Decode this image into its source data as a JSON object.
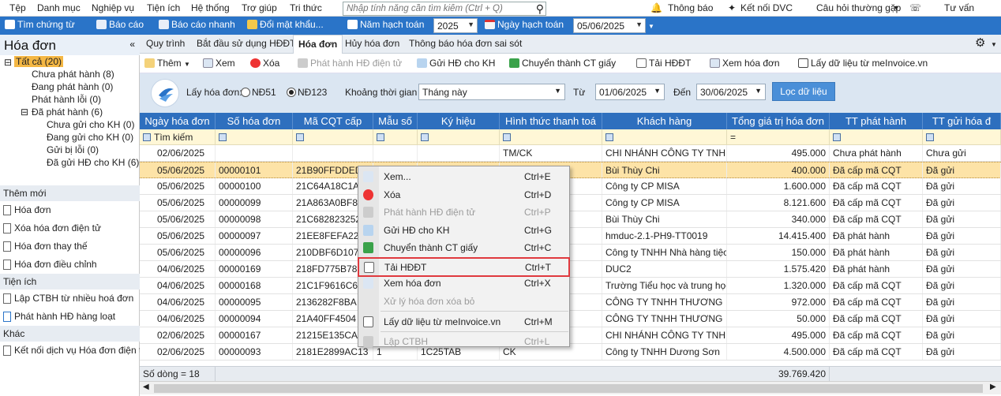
{
  "menubar": {
    "items": [
      "Tệp",
      "Danh mục",
      "Nghiệp vụ",
      "Tiện ích",
      "Hệ thống",
      "Trợ giúp",
      "Tri thức"
    ],
    "search_placeholder": "Nhập tính năng cần tìm kiếm (Ctrl + Q)",
    "right": [
      "Thông báo",
      "Kết nối DVC",
      "Câu hỏi thường gặp",
      "Tư vấn"
    ]
  },
  "toolbar": {
    "find_voucher": "Tìm chứng từ",
    "report": "Báo cáo",
    "quick_report": "Báo cáo nhanh",
    "change_password": "Đổi mật khẩu...",
    "year_label": "Năm hạch toán",
    "year_value": "2025",
    "date_label": "Ngày hạch toán",
    "date_value": "05/06/2025"
  },
  "sidebar": {
    "title": "Hóa đơn",
    "tree": [
      {
        "label": "Tất cả (20)",
        "selected": true,
        "level": 0
      },
      {
        "label": "Chưa phát hành (8)",
        "level": 1
      },
      {
        "label": "Đang phát hành (0)",
        "level": 1
      },
      {
        "label": "Phát hành lỗi (0)",
        "level": 1
      },
      {
        "label": "Đã phát hành (6)",
        "level": 1
      },
      {
        "label": "Chưa gửi cho KH (0)",
        "level": 2
      },
      {
        "label": "Đang gửi cho KH (0)",
        "level": 2
      },
      {
        "label": "Gửi bị lỗi (0)",
        "level": 2
      },
      {
        "label": "Đã gửi HĐ cho KH (6)",
        "level": 2
      }
    ],
    "section_new": "Thêm mới",
    "new_links": [
      "Hóa đơn",
      "Xóa hóa đơn điện tử",
      "Hóa đơn thay thế",
      "Hóa đơn điều chỉnh"
    ],
    "section_util": "Tiện ích",
    "util_links": [
      "Lập CTBH từ nhiều hoá đơn",
      "Phát hành HĐ hàng loạt"
    ],
    "section_other": "Khác",
    "other_links": [
      "Kết nối dịch vụ Hóa đơn điện t"
    ]
  },
  "tabs": [
    "Quy trình",
    "Bắt đầu sử dụng HĐĐT",
    "Hóa đơn",
    "Hủy hóa đơn",
    "Thông báo hóa đơn sai sót"
  ],
  "actions": {
    "add": "Thêm",
    "view": "Xem",
    "delete": "Xóa",
    "issue": "Phát hành HĐ điện tử",
    "send": "Gửi HĐ cho KH",
    "convert": "Chuyển thành CT giấy",
    "download": "Tải HĐĐT",
    "view_invoice": "Xem hóa đơn",
    "fetch": "Lấy dữ liệu từ meInvoice.vn"
  },
  "filter": {
    "get_label": "Lấy hóa đơn:",
    "opt1": "NĐ51",
    "opt2": "NĐ123",
    "period_label": "Khoảng thời gian",
    "period_value": "Tháng này",
    "from_label": "Từ",
    "from_value": "01/06/2025",
    "to_label": "Đến",
    "to_value": "30/06/2025",
    "load_button": "Lọc dữ liệu"
  },
  "grid": {
    "headers": [
      "Ngày hóa đơn",
      "Số hóa đơn",
      "Mã CQT cấp",
      "Mẫu số",
      "Ký hiệu",
      "Hình thức thanh toá",
      "Khách hàng",
      "Tổng giá trị hóa đơn",
      "TT phát hành",
      "TT gửi hóa đ"
    ],
    "filter_search": "Tìm kiếm",
    "rows": [
      [
        "02/06/2025",
        "",
        "",
        "",
        "",
        "TM/CK",
        "CHI NHÁNH CÔNG TY TNH",
        "495.000",
        "Chưa phát hành",
        "Chưa gửi"
      ],
      [
        "05/06/2025",
        "00000101",
        "21B90FFDDED",
        "",
        "",
        "",
        "Bùi Thùy Chi",
        "400.000",
        "Đã cấp mã CQT",
        "Đã gửi"
      ],
      [
        "05/06/2025",
        "00000100",
        "21C64A18C1A",
        "",
        "",
        "",
        "Công ty CP MISA",
        "1.600.000",
        "Đã cấp mã CQT",
        "Đã gửi"
      ],
      [
        "05/06/2025",
        "00000099",
        "21A863A0BF8",
        "",
        "",
        "",
        "Công ty CP MISA",
        "8.121.600",
        "Đã cấp mã CQT",
        "Đã gửi"
      ],
      [
        "05/06/2025",
        "00000098",
        "21C682823252",
        "",
        "",
        "",
        "Bùi Thùy Chi",
        "340.000",
        "Đã cấp mã CQT",
        "Đã gửi"
      ],
      [
        "05/06/2025",
        "00000097",
        "21EE8FEFA22",
        "",
        "",
        "",
        "hmduc-2.1-PH9-TT0019",
        "14.415.400",
        "Đã phát hành",
        "Đã gửi"
      ],
      [
        "05/06/2025",
        "00000096",
        "210DBF6D107",
        "",
        "",
        "",
        "Công ty TNHH Nhà hàng tiệc",
        "150.000",
        "Đã phát hành",
        "Đã gửi"
      ],
      [
        "04/06/2025",
        "00000169",
        "218FD775B78",
        "",
        "",
        "",
        "DUC2",
        "1.575.420",
        "Đã phát hành",
        "Đã gửi"
      ],
      [
        "04/06/2025",
        "00000168",
        "21C1F9616C6",
        "",
        "",
        "",
        "Trường Tiểu học và trung học",
        "1.320.000",
        "Đã cấp mã CQT",
        "Đã gửi"
      ],
      [
        "04/06/2025",
        "00000095",
        "2136282F8BA",
        "",
        "",
        "",
        "CÔNG TY TNHH THƯƠNG",
        "972.000",
        "Đã cấp mã CQT",
        "Đã gửi"
      ],
      [
        "04/06/2025",
        "00000094",
        "21A40FF4504",
        "",
        "",
        "",
        "CÔNG TY TNHH THƯƠNG",
        "50.000",
        "Đã cấp mã CQT",
        "Đã gửi"
      ],
      [
        "02/06/2025",
        "00000167",
        "21215E135CA",
        "",
        "",
        "",
        "CHI NHÁNH CÔNG TY TNH",
        "495.000",
        "Đã cấp mã CQT",
        "Đã gửi"
      ],
      [
        "02/06/2025",
        "00000093",
        "2181E2899AC13",
        "1",
        "1C25TAB",
        "CK",
        "Công ty TNHH Dương Sơn",
        "4.500.000",
        "Đã cấp mã CQT",
        "Đã gửi"
      ]
    ],
    "footer_count": "Số dòng = 18",
    "footer_total": "39.769.420"
  },
  "context_menu": [
    {
      "label": "Xem...",
      "shortcut": "Ctrl+E",
      "disabled": false
    },
    {
      "label": "Xóa",
      "shortcut": "Ctrl+D",
      "disabled": false
    },
    {
      "label": "Phát hành HĐ điện tử",
      "shortcut": "Ctrl+P",
      "disabled": true
    },
    {
      "label": "Gửi HĐ cho KH",
      "shortcut": "Ctrl+G",
      "disabled": false
    },
    {
      "label": "Chuyển thành CT giấy",
      "shortcut": "Ctrl+C",
      "disabled": false
    },
    {
      "label": "Tải HĐĐT",
      "shortcut": "Ctrl+T",
      "disabled": false,
      "highlighted": true
    },
    {
      "label": "Xem hóa đơn",
      "shortcut": "Ctrl+X",
      "disabled": false
    },
    {
      "label": "Xử lý hóa đơn xóa bỏ",
      "shortcut": "",
      "disabled": true
    },
    {
      "label": "Lấy dữ liệu từ meInvoice.vn",
      "shortcut": "Ctrl+M",
      "disabled": false
    },
    {
      "label": "Lập CTBH",
      "shortcut": "Ctrl+L",
      "disabled": true
    }
  ],
  "colors": {
    "header_blue": "#2e6fbe",
    "toolbar_blue": "#2a74c8",
    "selected_row": "#fde3a7",
    "highlight_red": "#e0393e"
  }
}
